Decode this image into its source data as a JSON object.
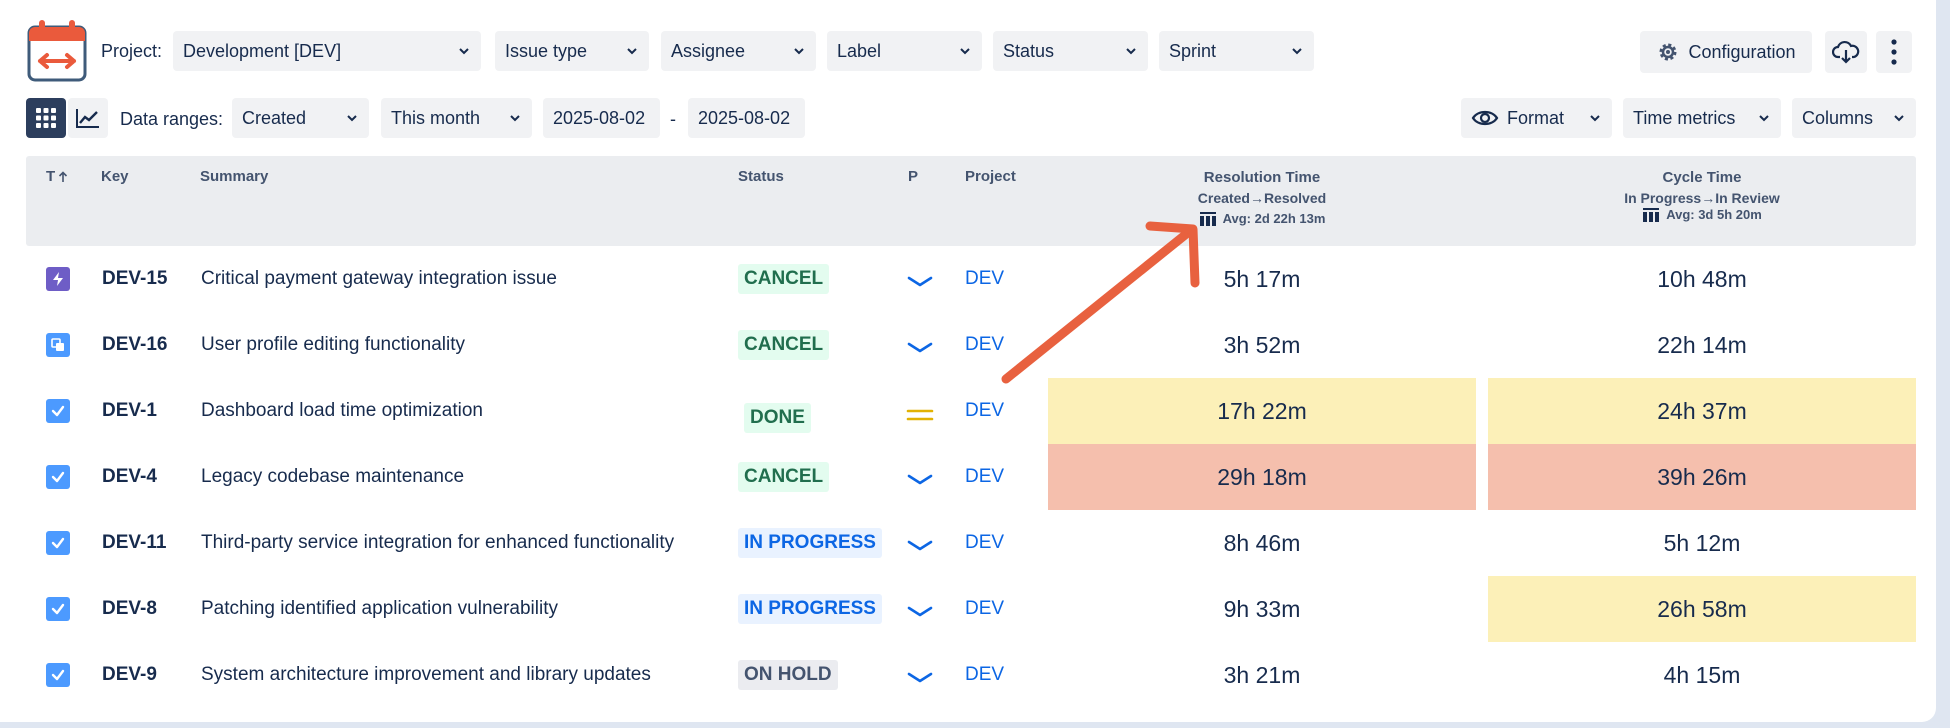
{
  "toolbar": {
    "project_label": "Project:",
    "project_value": "Development [DEV]",
    "filters": [
      "Issue type",
      "Assignee",
      "Label",
      "Status",
      "Sprint"
    ],
    "configuration_label": "Configuration",
    "data_ranges_label": "Data ranges:",
    "range_field": "Created",
    "range_period": "This month",
    "date_from": "2025-08-02",
    "date_sep": "-",
    "date_to": "2025-08-02",
    "format_label": "Format",
    "time_metrics_label": "Time metrics",
    "columns_label": "Columns"
  },
  "table": {
    "headers": {
      "type": "T",
      "key": "Key",
      "summary": "Summary",
      "status": "Status",
      "priority": "P",
      "project": "Project"
    },
    "resolution": {
      "title": "Resolution Time",
      "from": "Created",
      "to": "Resolved",
      "avg": "Avg: 2d 22h 13m"
    },
    "cycle": {
      "title": "Cycle Time",
      "from": "In Progress",
      "to": "In Review",
      "avg": "Avg: 3d 5h 20m"
    },
    "rows": [
      {
        "type": "epic",
        "key": "DEV-15",
        "summary": "Critical payment gateway integration issue",
        "status": "CANCEL",
        "status_color": "green",
        "priority": "low",
        "project": "DEV",
        "resolution": "5h 17m",
        "resolution_hl": "",
        "cycle": "10h 48m",
        "cycle_hl": ""
      },
      {
        "type": "subtask",
        "key": "DEV-16",
        "summary": "User profile editing functionality",
        "status": "CANCEL",
        "status_color": "green",
        "priority": "low",
        "project": "DEV",
        "resolution": "3h 52m",
        "resolution_hl": "",
        "cycle": "22h 14m",
        "cycle_hl": ""
      },
      {
        "type": "task",
        "key": "DEV-1",
        "summary": "Dashboard load time optimization",
        "status": "DONE",
        "status_color": "green",
        "priority": "medium",
        "project": "DEV",
        "resolution": "17h 22m",
        "resolution_hl": "yellow",
        "cycle": "24h 37m",
        "cycle_hl": "yellow"
      },
      {
        "type": "task",
        "key": "DEV-4",
        "summary": "Legacy codebase maintenance",
        "status": "CANCEL",
        "status_color": "green",
        "priority": "low",
        "project": "DEV",
        "resolution": "29h 18m",
        "resolution_hl": "red",
        "cycle": "39h 26m",
        "cycle_hl": "red"
      },
      {
        "type": "task",
        "key": "DEV-11",
        "summary": "Third-party service integration for enhanced functionality",
        "status": "IN PROGRESS",
        "status_color": "blue",
        "priority": "low",
        "project": "DEV",
        "resolution": "8h 46m",
        "resolution_hl": "",
        "cycle": "5h 12m",
        "cycle_hl": ""
      },
      {
        "type": "task",
        "key": "DEV-8",
        "summary": "Patching identified application vulnerability",
        "status": "IN PROGRESS",
        "status_color": "blue",
        "priority": "low",
        "project": "DEV",
        "resolution": "9h 33m",
        "resolution_hl": "",
        "cycle": "26h 58m",
        "cycle_hl": "yellow"
      },
      {
        "type": "task",
        "key": "DEV-9",
        "summary": "System architecture improvement and library updates",
        "status": "ON HOLD",
        "status_color": "gray",
        "priority": "low",
        "project": "DEV",
        "resolution": "3h 21m",
        "resolution_hl": "",
        "cycle": "4h 15m",
        "cycle_hl": ""
      }
    ]
  },
  "colors": {
    "accent": "#0c66e4",
    "logo": "#ea5a3c",
    "arrow": "#e8613f",
    "highlight_yellow": "#fcf0b8",
    "highlight_red": "#f5bfad"
  }
}
